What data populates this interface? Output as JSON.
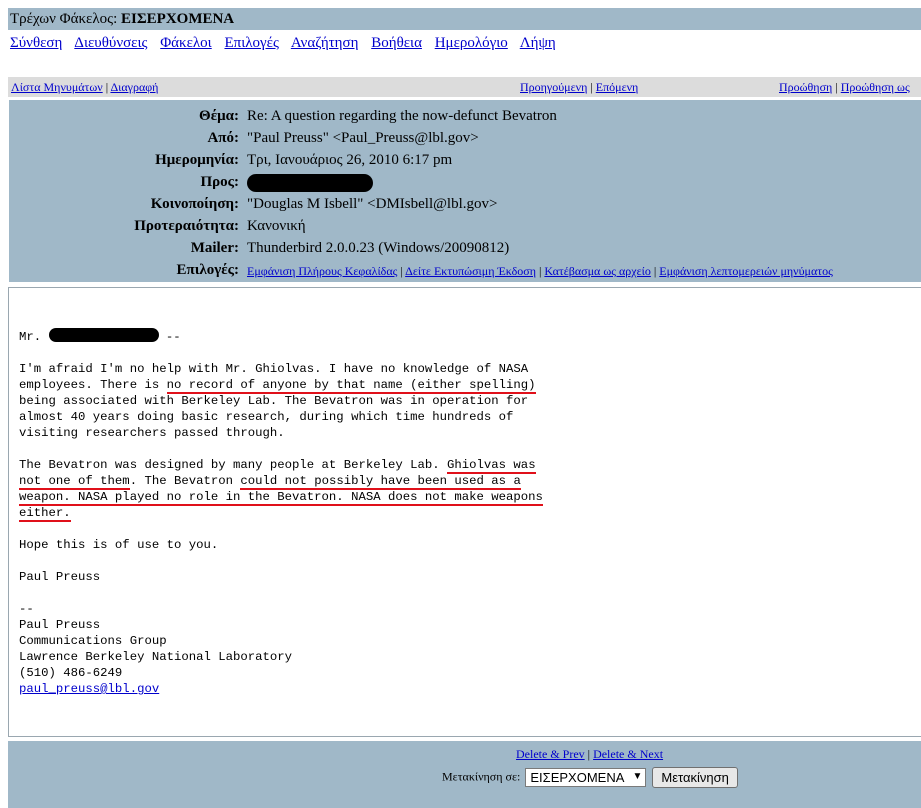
{
  "folderbar": {
    "prefix": "Τρέχων Φάκελος:",
    "folder": "ΕΙΣΕΡΧΟΜΕΝΑ"
  },
  "menu": {
    "items": [
      "Σύνθεση",
      "Διευθύνσεις",
      "Φάκελοι",
      "Επιλογές",
      "Αναζήτηση",
      "Βοήθεια",
      "Ημερολόγιο",
      "Λήψη"
    ]
  },
  "nav": {
    "message_list": "Λίστα Μηνυμάτων",
    "delete": "Διαγραφή",
    "previous": "Προηγούμενη",
    "next": "Επόμενη",
    "forward": "Προώθηση",
    "forward_attach": "Προώθηση ως"
  },
  "headers": {
    "subject_label": "Θέμα:",
    "subject": "Re: A question regarding the now-defunct Bevatron",
    "from_label": "Από:",
    "from": "\"Paul Preuss\" <Paul_Preuss@lbl.gov>",
    "date_label": "Ημερομηνία:",
    "date": "Τρι, Ιανουάριος 26, 2010 6:17 pm",
    "to_label": "Προς:",
    "cc_label": "Κοινοποίηση:",
    "cc": "\"Douglas M Isbell\" <DMIsbell@lbl.gov>",
    "priority_label": "Προτεραιότητα:",
    "priority": "Κανονική",
    "mailer_label": "Mailer:",
    "mailer": "Thunderbird 2.0.0.23 (Windows/20090812)",
    "options_label": "Επιλογές:",
    "options": [
      "Εμφάνιση Πλήρους Κεφαλίδας",
      "Δείτε Εκτυπώσιμη Έκδοση",
      "Κατέβασμα ως αρχείο",
      "Εμφάνιση λεπτομερειών μηνύματος"
    ]
  },
  "message": {
    "greeting_prefix": "Mr.",
    "greeting_suffix": "--",
    "p1_a": "I'm afraid I'm no help with Mr. Ghiolvas. I have no knowledge of NASA",
    "p1_b1": "employees. There is ",
    "p1_b2": "no record of anyone by that name (either spelling)",
    "p1_c": "being associated with Berkeley Lab. The Bevatron was in operation for",
    "p1_d": "almost 40 years doing basic research, during which time hundreds of",
    "p1_e": "visiting researchers passed through.",
    "p2_a1": "The Bevatron was designed by many people at Berkeley Lab. ",
    "p2_a2": "Ghiolvas was",
    "p2_b1": "not one of them",
    "p2_b2": ". The Bevatron ",
    "p2_b3": "could not possibly have been used as a",
    "p2_c": "weapon. NASA played no role in the Bevatron. NASA does not make weapons",
    "p2_d": "either.",
    "p3": "Hope this is of use to you.",
    "sign": "Paul Preuss",
    "sigsep": "--",
    "sig_name": "Paul Preuss",
    "sig_group": "Communications Group",
    "sig_lab": "Lawrence Berkeley National Laboratory",
    "sig_phone": "(510) 486-6249",
    "sig_email": "paul_preuss@lbl.gov"
  },
  "bottom": {
    "delete_prev": "Delete & Prev",
    "delete_next": "Delete & Next",
    "move_label": "Μετακίνηση σε:",
    "move_select": "ΕΙΣΕΡΧΟΜΕΝΑ",
    "move_button": "Μετακίνηση"
  },
  "colors": {
    "panel": "#a0b8c8",
    "link": "#0000cc",
    "underline_marks": "#e0101a"
  }
}
